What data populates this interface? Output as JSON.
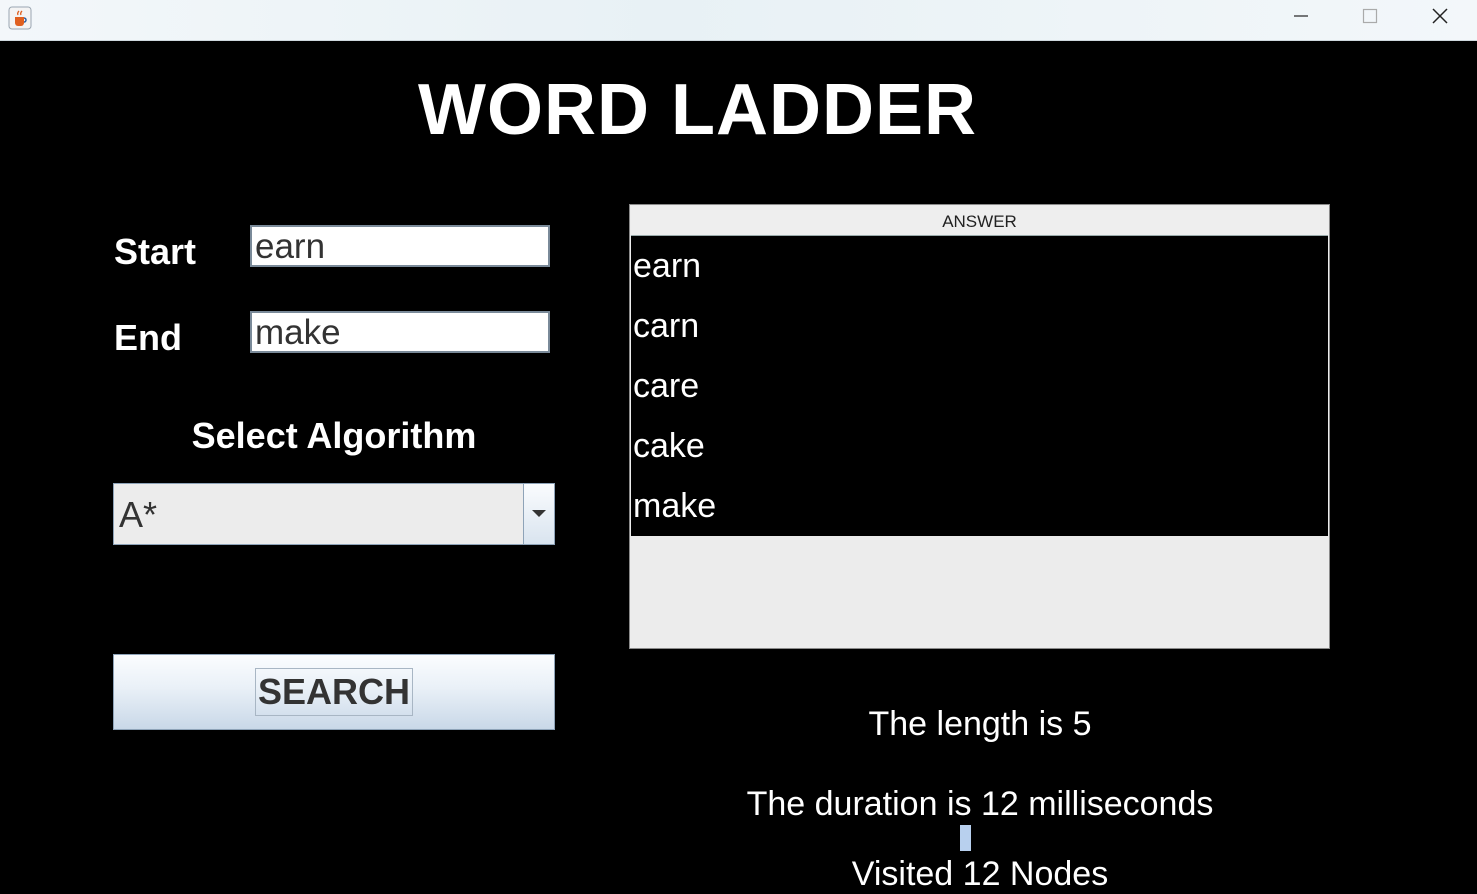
{
  "window": {
    "title": "",
    "icons": {
      "app": "java-cup-icon",
      "minimize": "minimize-icon",
      "maximize": "maximize-icon",
      "close": "close-icon"
    }
  },
  "app_title": "WORD LADDER",
  "form": {
    "start_label": "Start",
    "start_value": "earn",
    "end_label": "End",
    "end_value": "make",
    "algorithm_label": "Select Algorithm",
    "algorithm_value": "A*",
    "search_label": "SEARCH"
  },
  "answer": {
    "header": "ANSWER",
    "items": [
      "earn",
      "carn",
      "care",
      "cake",
      "make"
    ]
  },
  "stats": {
    "length": "The length is 5",
    "duration": "The duration is 12 milliseconds",
    "visited": "Visited 12 Nodes"
  },
  "colors": {
    "background": "#000000",
    "text": "#ffffff",
    "accent": "#b8d0ee"
  }
}
